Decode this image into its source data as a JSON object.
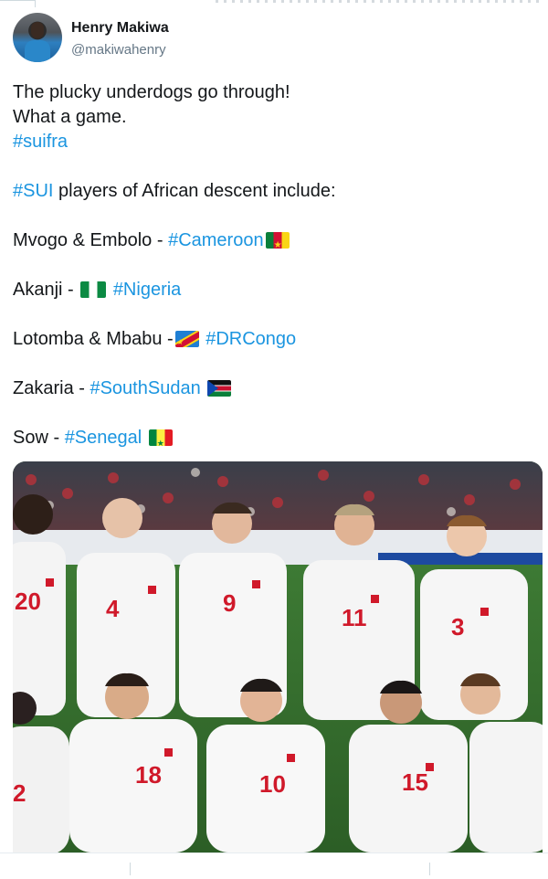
{
  "author": {
    "name": "Henry Makiwa",
    "handle": "@makiwahenry"
  },
  "tweet": {
    "line1": "The plucky underdogs go through!",
    "line2": "What a game.",
    "hashtag_suifra": "#suifra",
    "sui_tag": "#SUI",
    "sui_text": " players of African descent include:",
    "l1_text": "Mvogo & Embolo - ",
    "l1_tag": "#Cameroon",
    "l2_text": "Akanji - ",
    "l2_tag": "#Nigeria",
    "l3_text": "Lotomba & Mbabu -",
    "l3_tag": "#DRCongo",
    "l4_text": "Zakaria - ",
    "l4_tag": "#SouthSudan",
    "l5_text": "Sow  - ",
    "l5_tag": "#Senegal"
  },
  "flags": [
    "cameroon-flag-icon",
    "nigeria-flag-icon",
    "dr-congo-flag-icon",
    "south-sudan-flag-icon",
    "senegal-flag-icon"
  ],
  "photo": {
    "jersey_numbers": [
      "20",
      "4",
      "9",
      "11",
      "3",
      "2",
      "18",
      "10",
      "15"
    ]
  },
  "colors": {
    "link": "#1b95e0",
    "text": "#14171a",
    "muted": "#657786"
  }
}
